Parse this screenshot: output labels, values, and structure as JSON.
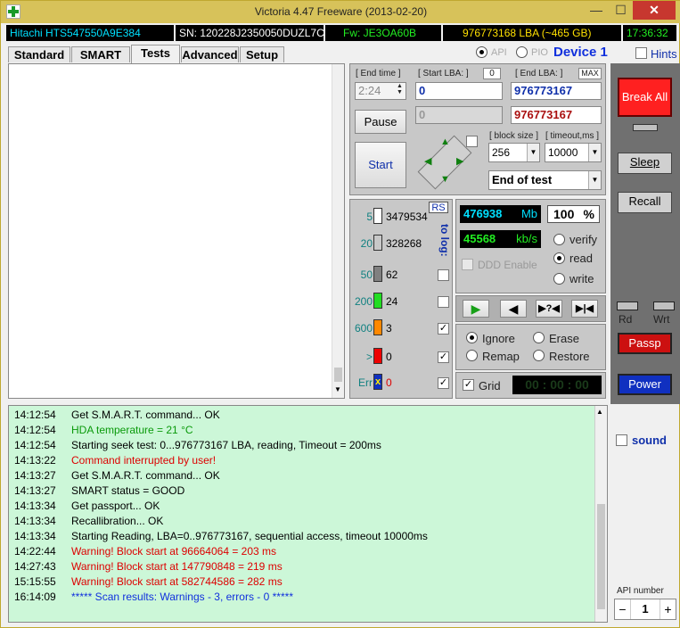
{
  "window": {
    "title": "Victoria 4.47  Freeware (2013-02-20)",
    "min_glyph": "—",
    "max_glyph": "☐",
    "close_glyph": "✕"
  },
  "infobar": {
    "model": "Hitachi HTS547550A9E384",
    "serial": "SN: 120228J2350050DUZL7C",
    "firmware": "Fw: JE3OA60B",
    "capacity": "976773168 LBA (~465 GB)",
    "clock": "17:36:32"
  },
  "tabs": [
    "Standard",
    "SMART",
    "Tests",
    "Advanced",
    "Setup"
  ],
  "mode": {
    "api": "API",
    "pio": "PIO",
    "device": "Device 1",
    "hints": "Hints"
  },
  "tests": {
    "end_time_label": "[ End time ]",
    "end_time_value": "2:24",
    "start_lba_label": "[ Start LBA: ]",
    "start_lba_zero": "0",
    "start_lba_value": "0",
    "start_lba_current": "0",
    "end_lba_label": "[ End LBA: ]",
    "max_label": "MAX",
    "end_lba_value": "976773167",
    "end_lba_current": "976773167",
    "pause_label": "Pause",
    "start_label": "Start",
    "block_size_label": "[ block size ]",
    "block_size_value": "256",
    "timeout_label": "[ timeout,ms ]",
    "timeout_value": "10000",
    "end_action": "End of test"
  },
  "blocks": {
    "rs_label": "RS",
    "to_log_label": "to log:",
    "rows": [
      {
        "threshold": "5",
        "count": "3479534",
        "color": "#ffffff",
        "logged": false,
        "show_check": false
      },
      {
        "threshold": "20",
        "count": "328268",
        "color": "#c8c8c8",
        "logged": false,
        "show_check": false
      },
      {
        "threshold": "50",
        "count": "62",
        "color": "#808080",
        "logged": false,
        "show_check": true
      },
      {
        "threshold": "200",
        "count": "24",
        "color": "#22dd22",
        "logged": false,
        "show_check": true
      },
      {
        "threshold": "600",
        "count": "3",
        "color": "#ff8800",
        "logged": true,
        "show_check": true
      },
      {
        "threshold": ">",
        "count": "0",
        "color": "#ee0000",
        "logged": true,
        "show_check": true
      },
      {
        "threshold": "Err",
        "count": "0",
        "color": "#1030c0",
        "logged": true,
        "show_check": true,
        "mark": "x"
      }
    ]
  },
  "stats": {
    "mb_value": "476938",
    "mb_unit": "Mb",
    "percent_value": "100",
    "percent_unit": "%",
    "speed_value": "45568",
    "speed_unit": "kb/s",
    "ddd_label": "DDD Enable",
    "verify": "verify",
    "read": "read",
    "write": "write",
    "ignore": "Ignore",
    "erase": "Erase",
    "remap": "Remap",
    "restore": "Restore",
    "grid": "Grid",
    "grid_timer": "00 : 00 : 00"
  },
  "right": {
    "break_all": "Break All",
    "sleep": "Sleep",
    "recall": "Recall",
    "rd": "Rd",
    "wrt": "Wrt",
    "passp": "Passp",
    "power": "Power",
    "sound": "sound",
    "api_number_label": "API number",
    "api_number_value": "1",
    "minus": "−",
    "plus": "+"
  },
  "log": [
    {
      "time": "14:12:54",
      "msg": "Get S.M.A.R.T. command... OK",
      "color": "#000000"
    },
    {
      "time": "14:12:54",
      "msg": "HDA temperature = 21 °C",
      "color": "#0a9a0a"
    },
    {
      "time": "14:12:54",
      "msg": "Starting seek test: 0...976773167 LBA, reading, Timeout = 200ms",
      "color": "#000000"
    },
    {
      "time": "14:13:22",
      "msg": "Command interrupted by user!",
      "color": "#dd0000"
    },
    {
      "time": "14:13:27",
      "msg": "Get S.M.A.R.T. command... OK",
      "color": "#000000"
    },
    {
      "time": "14:13:27",
      "msg": "SMART status = GOOD",
      "color": "#000000"
    },
    {
      "time": "14:13:34",
      "msg": "Get passport... OK",
      "color": "#000000"
    },
    {
      "time": "14:13:34",
      "msg": "Recallibration... OK",
      "color": "#000000"
    },
    {
      "time": "14:13:34",
      "msg": "Starting Reading, LBA=0..976773167, sequential access, timeout 10000ms",
      "color": "#000000"
    },
    {
      "time": "14:22:44",
      "msg": "Warning! Block start at 96664064 = 203 ms",
      "color": "#dd0000"
    },
    {
      "time": "14:27:43",
      "msg": "Warning! Block start at 147790848 = 219 ms",
      "color": "#dd0000"
    },
    {
      "time": "15:15:55",
      "msg": "Warning! Block start at 582744586 = 282 ms",
      "color": "#dd0000"
    },
    {
      "time": "16:14:09",
      "msg": "***** Scan results: Warnings - 3, errors - 0 *****",
      "color": "#1030dd"
    }
  ],
  "colors": {
    "title_bg": "#d7c25a",
    "log_bg": "#ccf7d8",
    "break_all": "#ff2020",
    "passp": "#cc1010",
    "power": "#1030c0",
    "right_panel": "#707070"
  }
}
